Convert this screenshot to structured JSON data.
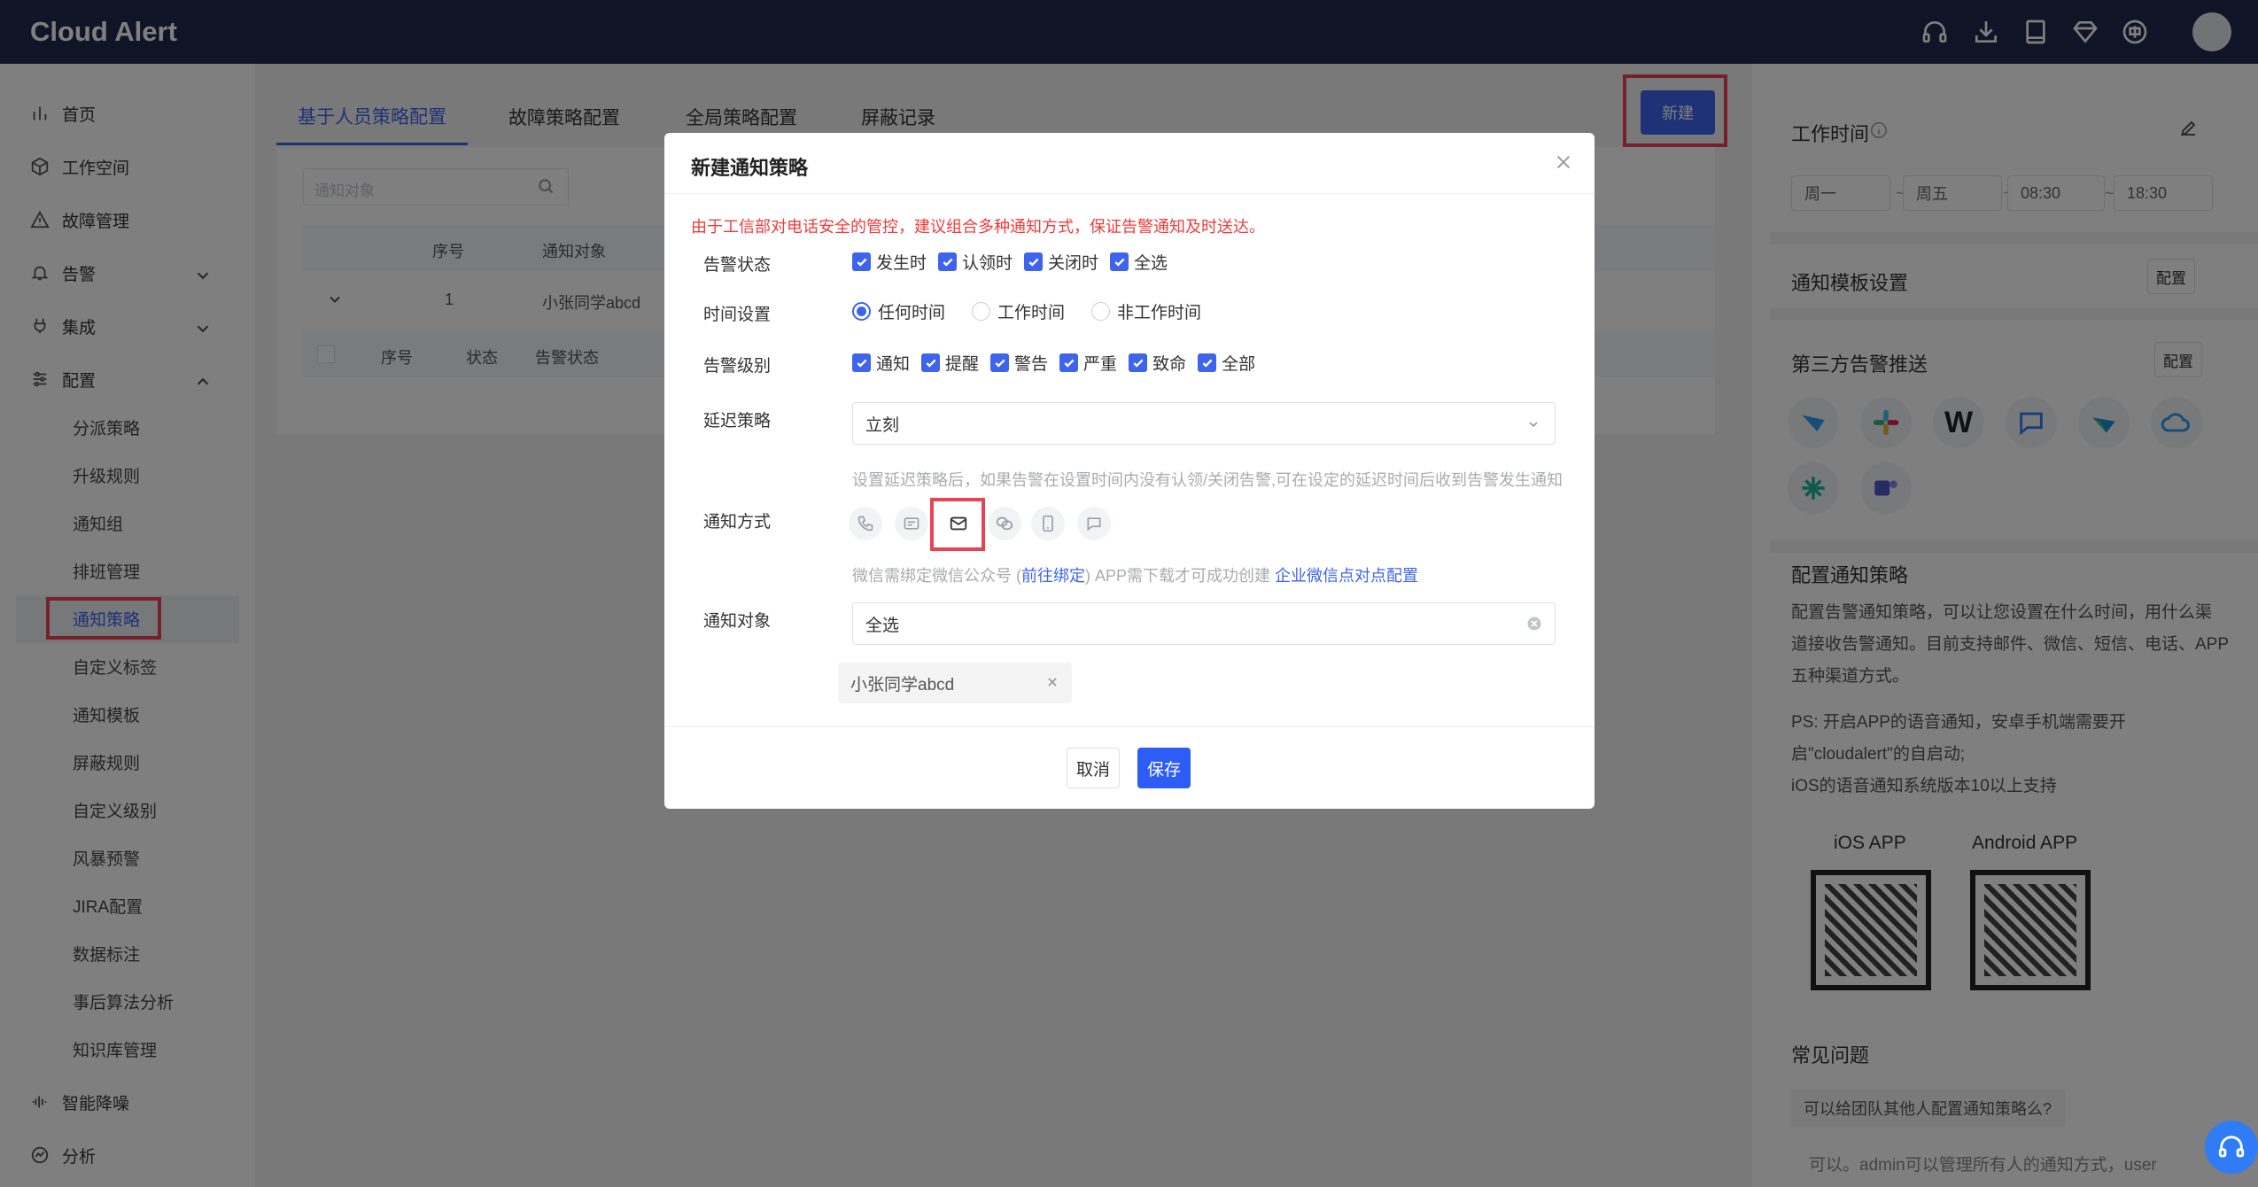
{
  "app": {
    "title": "Cloud Alert"
  },
  "header": {
    "icons": [
      "headset-icon",
      "download-icon",
      "book-icon",
      "diamond-icon",
      "language-icon"
    ]
  },
  "sidebar": {
    "items": [
      {
        "label": "首页",
        "icon": "bar-chart-icon"
      },
      {
        "label": "工作空间",
        "icon": "cube-icon"
      },
      {
        "label": "故障管理",
        "icon": "warning-icon"
      },
      {
        "label": "告警",
        "icon": "bell-icon"
      },
      {
        "label": "集成",
        "icon": "plug-icon"
      },
      {
        "label": "配置",
        "icon": "sliders-icon"
      }
    ],
    "sub_items": [
      "分派策略",
      "升级规则",
      "通知组",
      "排班管理",
      "通知策略",
      "自定义标签",
      "通知模板",
      "屏蔽规则",
      "自定义级别",
      "风暴预警",
      "JIRA配置",
      "数据标注",
      "事后算法分析",
      "知识库管理"
    ],
    "bottom_items": [
      {
        "label": "智能降噪",
        "icon": "waveform-icon"
      },
      {
        "label": "分析",
        "icon": "analysis-icon"
      }
    ]
  },
  "tabs": [
    "基于人员策略配置",
    "故障策略配置",
    "全局策略配置",
    "屏蔽记录"
  ],
  "background": {
    "search_placeholder": "通知对象",
    "table1_headers": [
      "序号",
      "通知对象"
    ],
    "table1_row": [
      "1",
      "小张同学abcd"
    ],
    "table2_headers": [
      "序号",
      "状态",
      "告警状态"
    ],
    "new_button": "新建"
  },
  "right_panel": {
    "work_time_title": "工作时间",
    "day_from": "周一",
    "day_to": "周五",
    "time_from": "08:30",
    "time_to": "18:30",
    "template_title": "通知模板设置",
    "config_label": "配置",
    "third_party_title": "第三方告警推送",
    "config_policy_title": "配置通知策略",
    "desc": [
      "配置告警通知策略，可以让您设置在什么时间，用什么渠",
      "道接收告警通知。目前支持邮件、微信、短信、电话、APP",
      "五种渠道方式。"
    ],
    "ps": [
      "PS: 开启APP的语音通知，安卓手机端需要开",
      "启\"cloudalert\"的自启动;",
      "iOS的语音通知系统版本10以上支持"
    ],
    "ios_app": "iOS APP",
    "android_app": "Android APP",
    "faq_title": "常见问题",
    "faq_q": "可以给团队其他人配置通知策略么?",
    "faq_a": "可以。admin可以管理所有人的通知方式，user"
  },
  "modal": {
    "title": "新建通知策略",
    "warning": "由于工信部对电话安全的管控，建议组合多种通知方式，保证告警通知及时送达。",
    "alert_status_label": "告警状态",
    "alert_status_options": [
      "发生时",
      "认领时",
      "关闭时",
      "全选"
    ],
    "time_label": "时间设置",
    "time_options": [
      "任何时间",
      "工作时间",
      "非工作时间"
    ],
    "time_selected": "任何时间",
    "level_label": "告警级别",
    "level_options": [
      "通知",
      "提醒",
      "警告",
      "严重",
      "致命",
      "全部"
    ],
    "delay_label": "延迟策略",
    "delay_value": "立刻",
    "delay_hint": "设置延迟策略后，如果告警在设置时间内没有认领/关闭告警,可在设定的延迟时间后收到告警发生通知",
    "method_label": "通知方式",
    "method_icons": [
      "phone-icon",
      "sms-icon",
      "email-icon",
      "wechat-icon",
      "mobile-app-icon",
      "chat-icon"
    ],
    "selected_method": "email-icon",
    "method_hint_1": "微信需绑定微信公众号 (",
    "method_hint_link1": "前往绑定",
    "method_hint_2": ") APP需下载才可成功创建",
    "method_hint_link2": "企业微信点对点配置",
    "target_label": "通知对象",
    "target_value": "全选",
    "target_tag": "小张同学abcd",
    "cancel": "取消",
    "save": "保存"
  },
  "colors": {
    "primary": "#3e64ee",
    "header_bg": "#1f2a4d",
    "warning_text": "#f03a3a",
    "highlight_box": "#e84352"
  }
}
